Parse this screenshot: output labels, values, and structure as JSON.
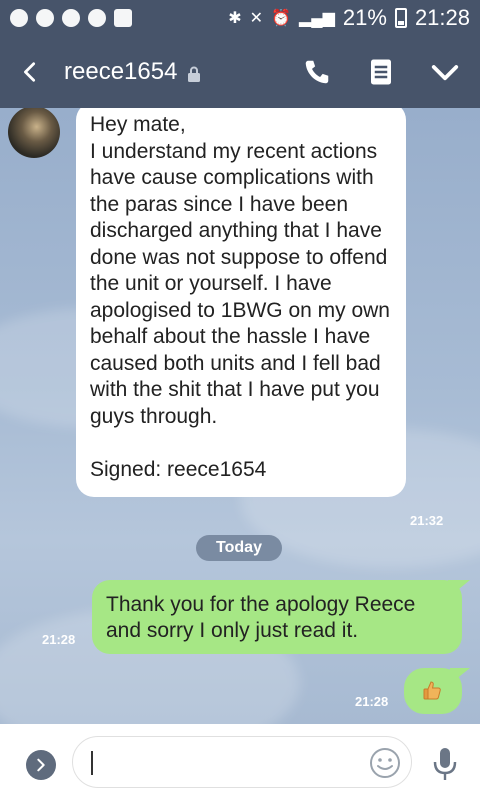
{
  "status": {
    "battery": "21%",
    "time": "21:28"
  },
  "header": {
    "title": "reece1654"
  },
  "chat": {
    "incoming_message": "Hey mate,\nI understand my recent actions have cause complications with the paras since I have been discharged anything that I have done was not suppose to offend the unit or yourself. I have apologised to 1BWG on my own behalf about the hassle I have caused both units and I fell bad with the shit that I have put you guys through.\n\nSigned: reece1654",
    "incoming_time": "21:32",
    "day_label": "Today",
    "outgoing_message": "Thank you for the apology Reece\nand sorry I only just read it.",
    "outgoing_time": "21:28",
    "sticker_time": "21:28",
    "sticker_icon": "thumbs-up-icon"
  },
  "input": {
    "placeholder": ""
  },
  "colors": {
    "header": "#47546a",
    "outgoing_bubble": "#a6e785",
    "incoming_bubble": "#ffffff"
  }
}
